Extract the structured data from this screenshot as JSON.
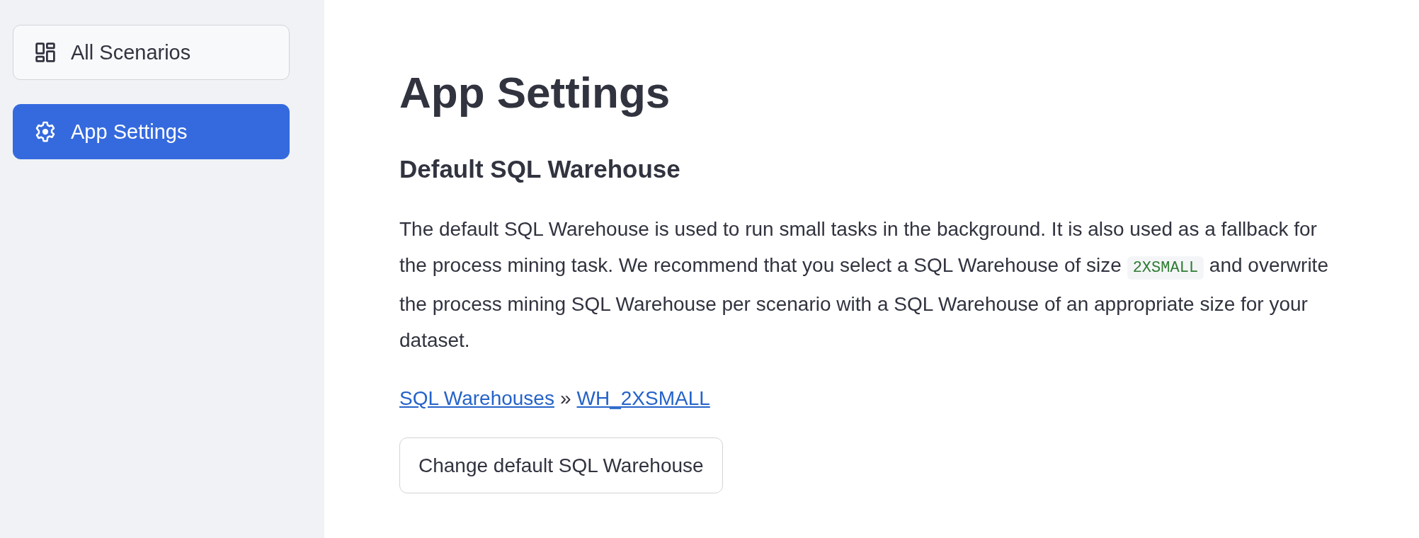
{
  "sidebar": {
    "items": [
      {
        "kind": "dashboard",
        "label": "All Scenarios",
        "selected": false
      },
      {
        "kind": "settings",
        "label": "App Settings",
        "selected": true
      }
    ]
  },
  "page": {
    "title": "App Settings",
    "section": {
      "heading": "Default SQL Warehouse",
      "description": [
        {
          "kind": "text",
          "text": "The default SQL Warehouse is used to run small tasks in the background. It is also used as a fallback for the process mining task. We recommend that you select a SQL Warehouse of size "
        },
        {
          "kind": "code",
          "text": "2XSMALL"
        },
        {
          "kind": "text",
          "text": " and overwrite the process mining SQL Warehouse per scenario with a SQL Warehouse of an appropriate size for your dataset."
        }
      ],
      "breadcrumb": {
        "items": [
          "SQL Warehouses",
          "WH_2XSMALL"
        ],
        "separator": "»"
      },
      "button": {
        "label": "Change default SQL Warehouse"
      }
    }
  }
}
